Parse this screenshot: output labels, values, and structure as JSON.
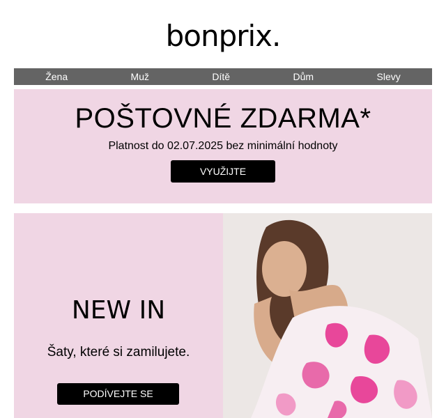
{
  "brand": {
    "logo_text": "bonprix."
  },
  "nav": {
    "items": [
      "Žena",
      "Muž",
      "Dítě",
      "Dům",
      "Slevy"
    ]
  },
  "promo": {
    "title": "POŠTOVNÉ ZDARMA*",
    "subtitle": "Platnost do 02.07.2025 bez minimální hodnoty",
    "button_label": "VYUŽIJTE"
  },
  "hero": {
    "title": "NEW IN",
    "subtitle": "Šaty, které si zamilujete.",
    "button_label": "PODÍVEJTE SE"
  },
  "colors": {
    "pink_background": "#f0d6e4",
    "nav_background": "#646464",
    "button_background": "#000000",
    "accent_pink": "#e8479a"
  }
}
